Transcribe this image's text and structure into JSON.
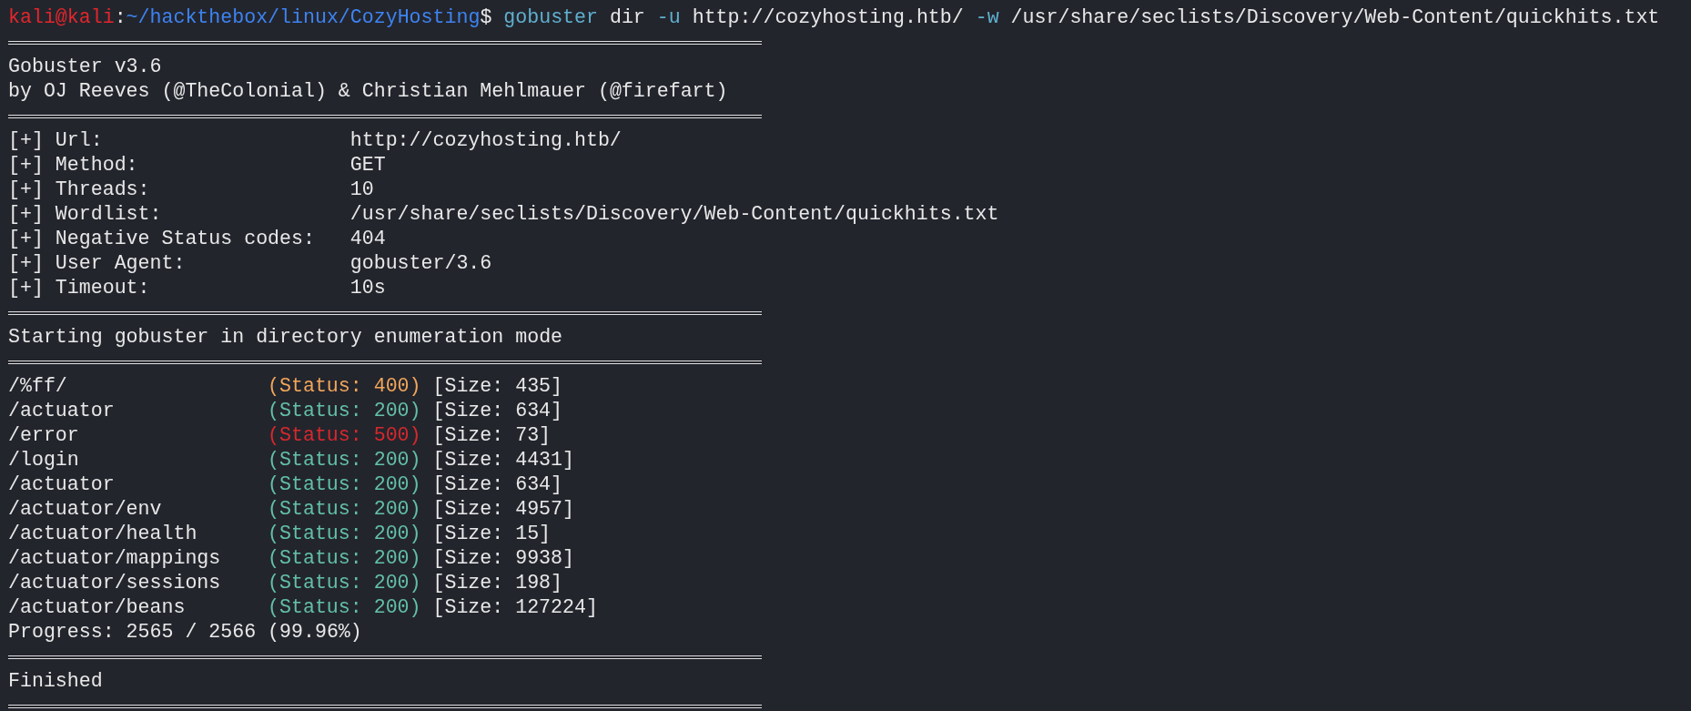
{
  "prompt": {
    "user_host": "kali@kali",
    "separator": ":",
    "path": "~/hackthebox/linux/CozyHosting",
    "symbol": "$"
  },
  "command": [
    {
      "kind": "program",
      "text": "gobuster"
    },
    {
      "kind": "arg",
      "text": "dir"
    },
    {
      "kind": "flag",
      "text": "-u"
    },
    {
      "kind": "arg",
      "text": "http://cozyhosting.htb/"
    },
    {
      "kind": "flag",
      "text": "-w"
    },
    {
      "kind": "arg",
      "text": "/usr/share/seclists/Discovery/Web-Content/quickhits.txt"
    }
  ],
  "banner": [
    "Gobuster v3.6",
    "by OJ Reeves (@TheColonial) & Christian Mehlmauer (@firefart)"
  ],
  "settings": [
    {
      "label": "[+] Url:",
      "value": "http://cozyhosting.htb/"
    },
    {
      "label": "[+] Method:",
      "value": "GET"
    },
    {
      "label": "[+] Threads:",
      "value": "10"
    },
    {
      "label": "[+] Wordlist:",
      "value": "/usr/share/seclists/Discovery/Web-Content/quickhits.txt"
    },
    {
      "label": "[+] Negative Status codes:",
      "value": "404"
    },
    {
      "label": "[+] User Agent:",
      "value": "gobuster/3.6"
    },
    {
      "label": "[+] Timeout:",
      "value": "10s"
    }
  ],
  "mode_message": "Starting gobuster in directory enumeration mode",
  "results": [
    {
      "path": "/%ff/",
      "status": "(Status: 400)",
      "color": "#f2a65a",
      "size": "[Size: 435]"
    },
    {
      "path": "/actuator",
      "status": "(Status: 200)",
      "color": "#62c0a6",
      "size": "[Size: 634]"
    },
    {
      "path": "/error",
      "status": "(Status: 500)",
      "color": "#d8282c",
      "size": "[Size: 73]"
    },
    {
      "path": "/login",
      "status": "(Status: 200)",
      "color": "#62c0a6",
      "size": "[Size: 4431]"
    },
    {
      "path": "/actuator",
      "status": "(Status: 200)",
      "color": "#62c0a6",
      "size": "[Size: 634]"
    },
    {
      "path": "/actuator/env",
      "status": "(Status: 200)",
      "color": "#62c0a6",
      "size": "[Size: 4957]"
    },
    {
      "path": "/actuator/health",
      "status": "(Status: 200)",
      "color": "#62c0a6",
      "size": "[Size: 15]"
    },
    {
      "path": "/actuator/mappings",
      "status": "(Status: 200)",
      "color": "#62c0a6",
      "size": "[Size: 9938]"
    },
    {
      "path": "/actuator/sessions",
      "status": "(Status: 200)",
      "color": "#62c0a6",
      "size": "[Size: 198]"
    },
    {
      "path": "/actuator/beans",
      "status": "(Status: 200)",
      "color": "#62c0a6",
      "size": "[Size: 127224]"
    }
  ],
  "progress": "Progress: 2565 / 2566 (99.96%)",
  "final_message": "Finished"
}
